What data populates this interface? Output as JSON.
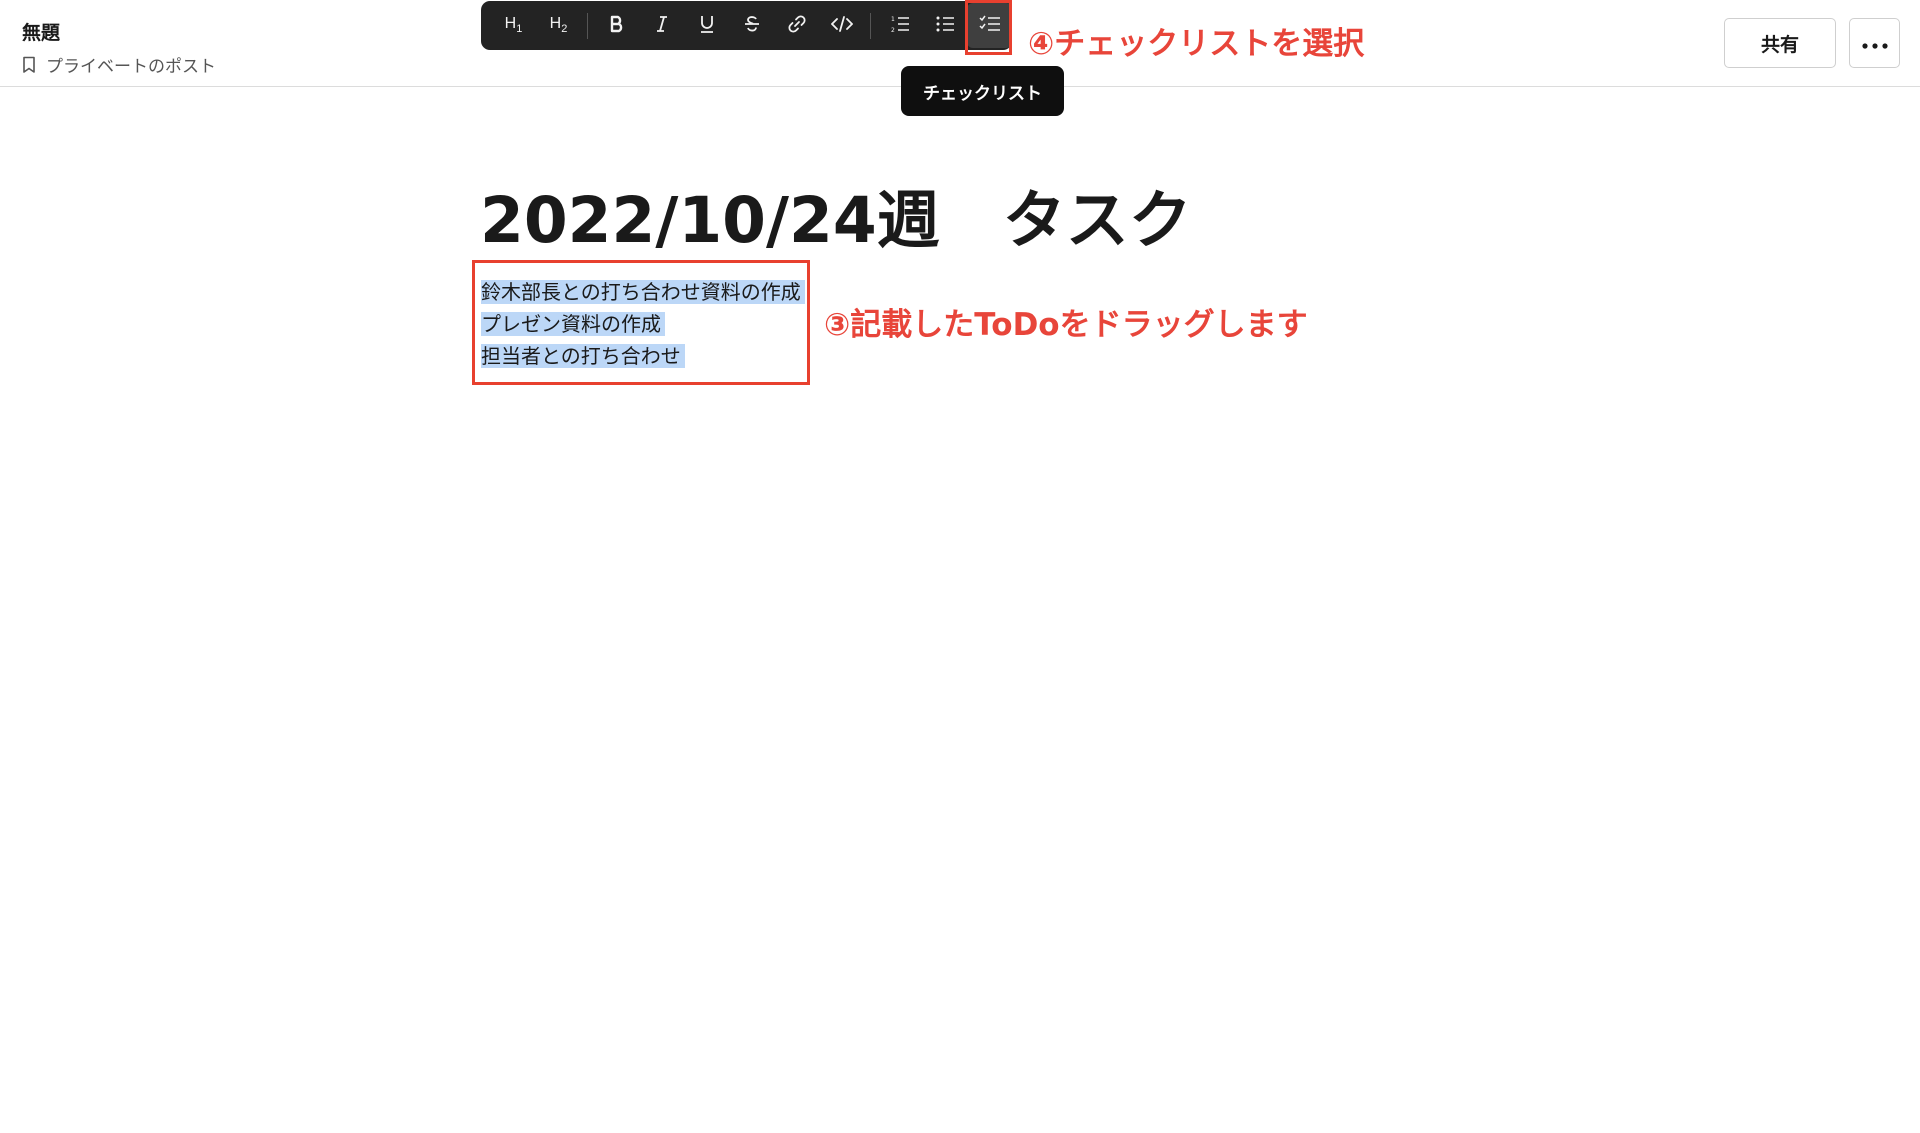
{
  "header": {
    "doc_title": "無題",
    "visibility_label": "プライベートのポスト",
    "share_label": "共有"
  },
  "toolbar": {
    "buttons": [
      {
        "name": "heading1",
        "label": "H1",
        "icon": "h1-icon"
      },
      {
        "name": "heading2",
        "label": "H2",
        "icon": "h2-icon"
      },
      {
        "name": "bold",
        "icon": "bold-icon"
      },
      {
        "name": "italic",
        "icon": "italic-icon"
      },
      {
        "name": "underline",
        "icon": "underline-icon"
      },
      {
        "name": "strikethrough",
        "icon": "strikethrough-icon"
      },
      {
        "name": "link",
        "icon": "link-icon"
      },
      {
        "name": "code",
        "icon": "code-icon"
      },
      {
        "name": "ordered-list",
        "icon": "ordered-list-icon"
      },
      {
        "name": "bullet-list",
        "icon": "bullet-list-icon"
      },
      {
        "name": "checklist",
        "icon": "checklist-icon",
        "active": true
      }
    ],
    "tooltip": "チェックリスト"
  },
  "annotations": {
    "step4": "④チェックリストを選択",
    "step3": "③記載したToDoをドラッグします",
    "color": "#e8453a"
  },
  "content": {
    "heading": "2022/10/24週　タスク",
    "lines": [
      "鈴木部長との打ち合わせ資料の作成",
      "プレゼン資料の作成",
      "担当者との打ち合わせ"
    ]
  },
  "colors": {
    "toolbar_bg": "#232323",
    "selection": "#bcd7f7",
    "highlight_border": "#e8402f"
  }
}
